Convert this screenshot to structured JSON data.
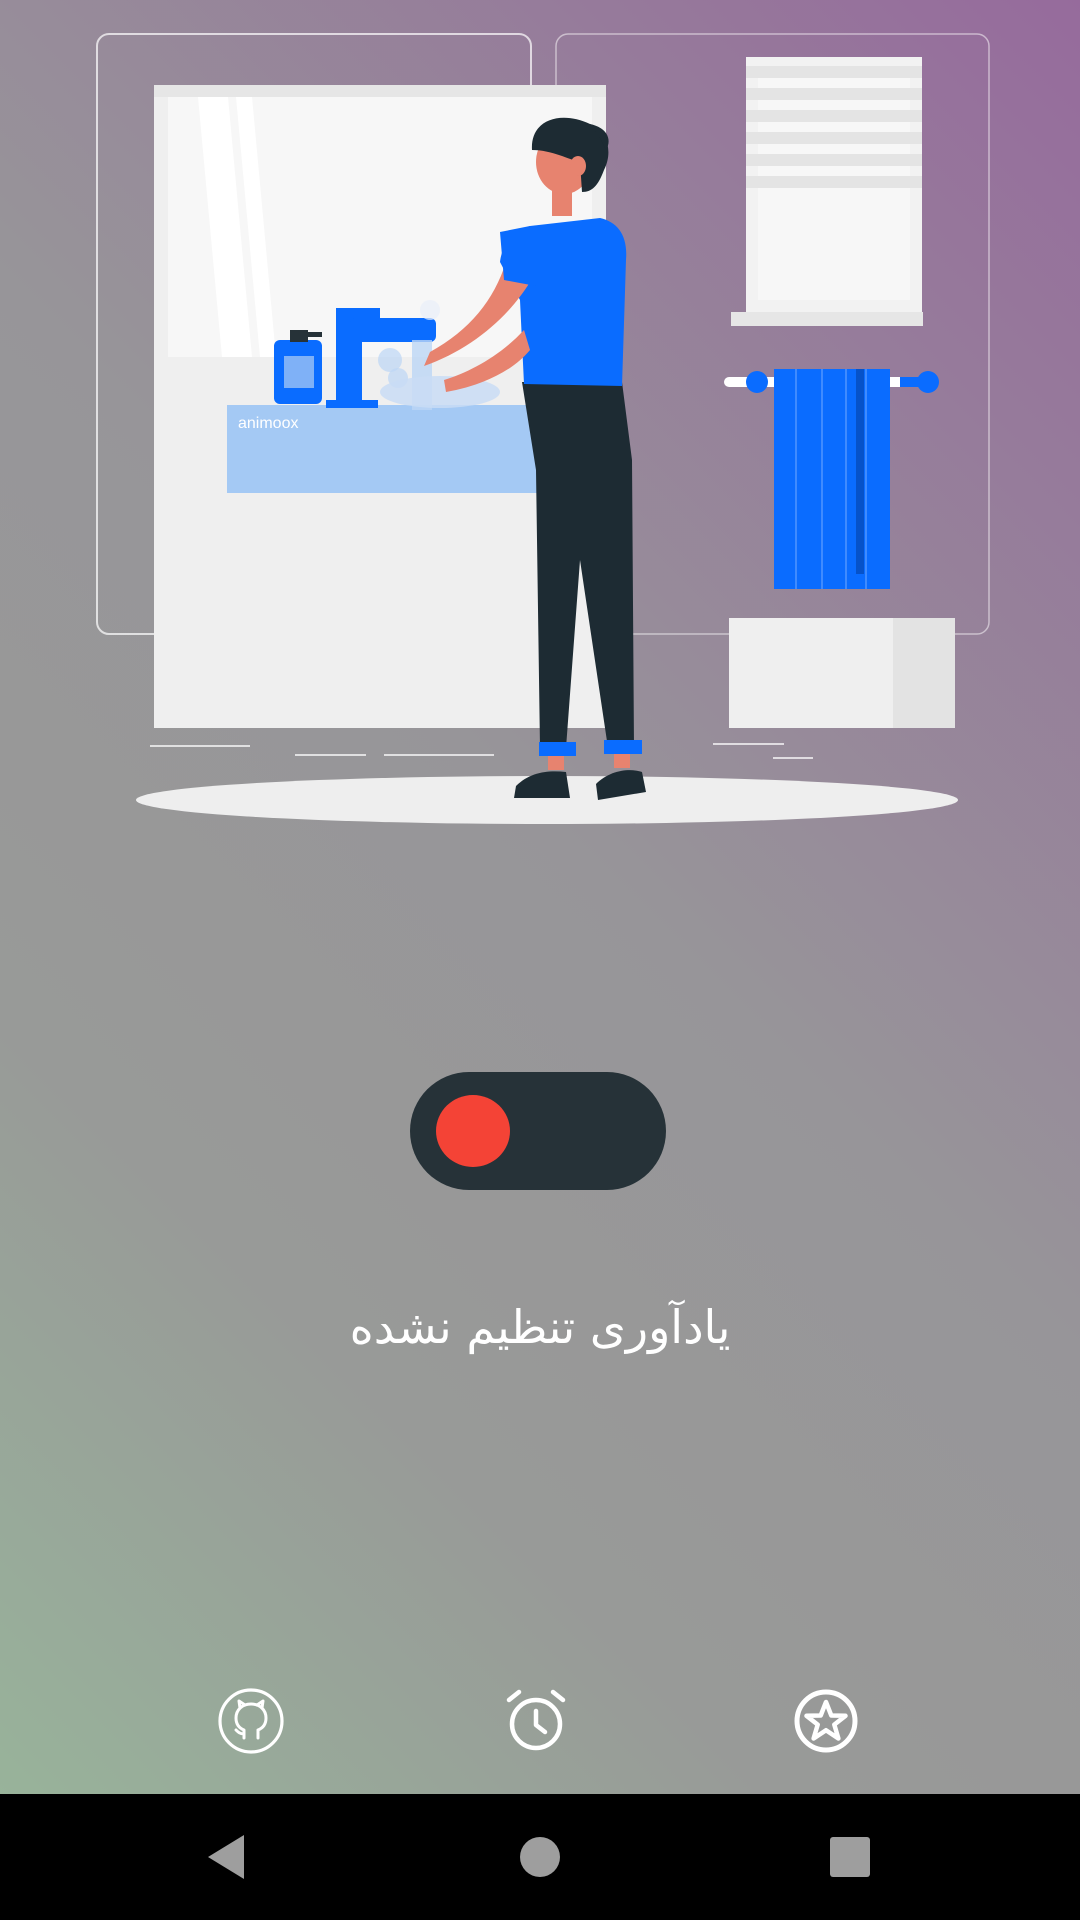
{
  "illustration": {
    "name": "man washing hands at bathroom sink",
    "watermark": "animoox"
  },
  "reminder": {
    "toggle_state": "off",
    "toggle_track_color": "#263238",
    "toggle_knob_color": "#f44336",
    "status_text": "یادآوری تنظیم نشده"
  },
  "action_bar": {
    "icons": [
      "github-icon",
      "alarm-clock-icon",
      "star-badge-icon"
    ]
  },
  "nav_bar": {
    "buttons": [
      "back-icon",
      "home-icon",
      "recents-icon"
    ]
  },
  "colors": {
    "accent_blue": "#0a6cff",
    "dark": "#263238",
    "red": "#f44336"
  }
}
